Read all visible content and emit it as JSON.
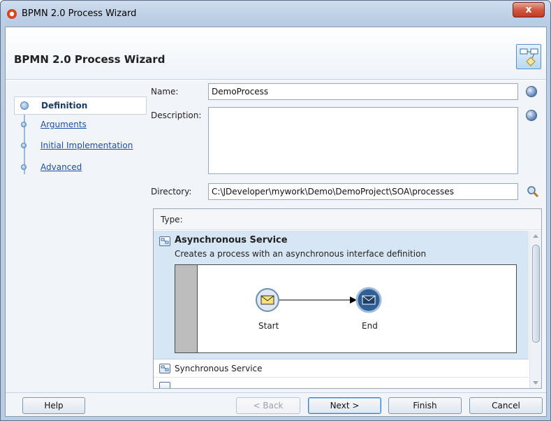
{
  "window": {
    "title": "BPMN 2.0 Process Wizard",
    "close_glyph": "x"
  },
  "banner": {
    "title": "BPMN 2.0 Process Wizard",
    "icon": "process-flow-icon"
  },
  "steps": [
    {
      "label": "Definition",
      "active": true
    },
    {
      "label": "Arguments",
      "active": false
    },
    {
      "label": "Initial Implementation",
      "active": false
    },
    {
      "label": "Advanced",
      "active": false
    }
  ],
  "form": {
    "name_label": "Name:",
    "name_value": "DemoProcess",
    "description_label": "Description:",
    "description_value": "",
    "directory_label": "Directory:",
    "directory_value": "C:\\JDeveloper\\mywork\\Demo\\DemoProject\\SOA\\processes",
    "type_label": "Type:"
  },
  "types": {
    "selected": {
      "title": "Asynchronous Service",
      "description": "Creates a process with an asynchronous interface definition",
      "diagram": {
        "start_label": "Start",
        "end_label": "End"
      }
    },
    "items": [
      {
        "label": "Synchronous Service"
      }
    ]
  },
  "footer": {
    "help": "Help",
    "back": "< Back",
    "next": "Next >",
    "finish": "Finish",
    "cancel": "Cancel"
  },
  "colors": {
    "link": "#1c4ea5",
    "selection": "#d6e6f4",
    "close": "#c23a22"
  }
}
